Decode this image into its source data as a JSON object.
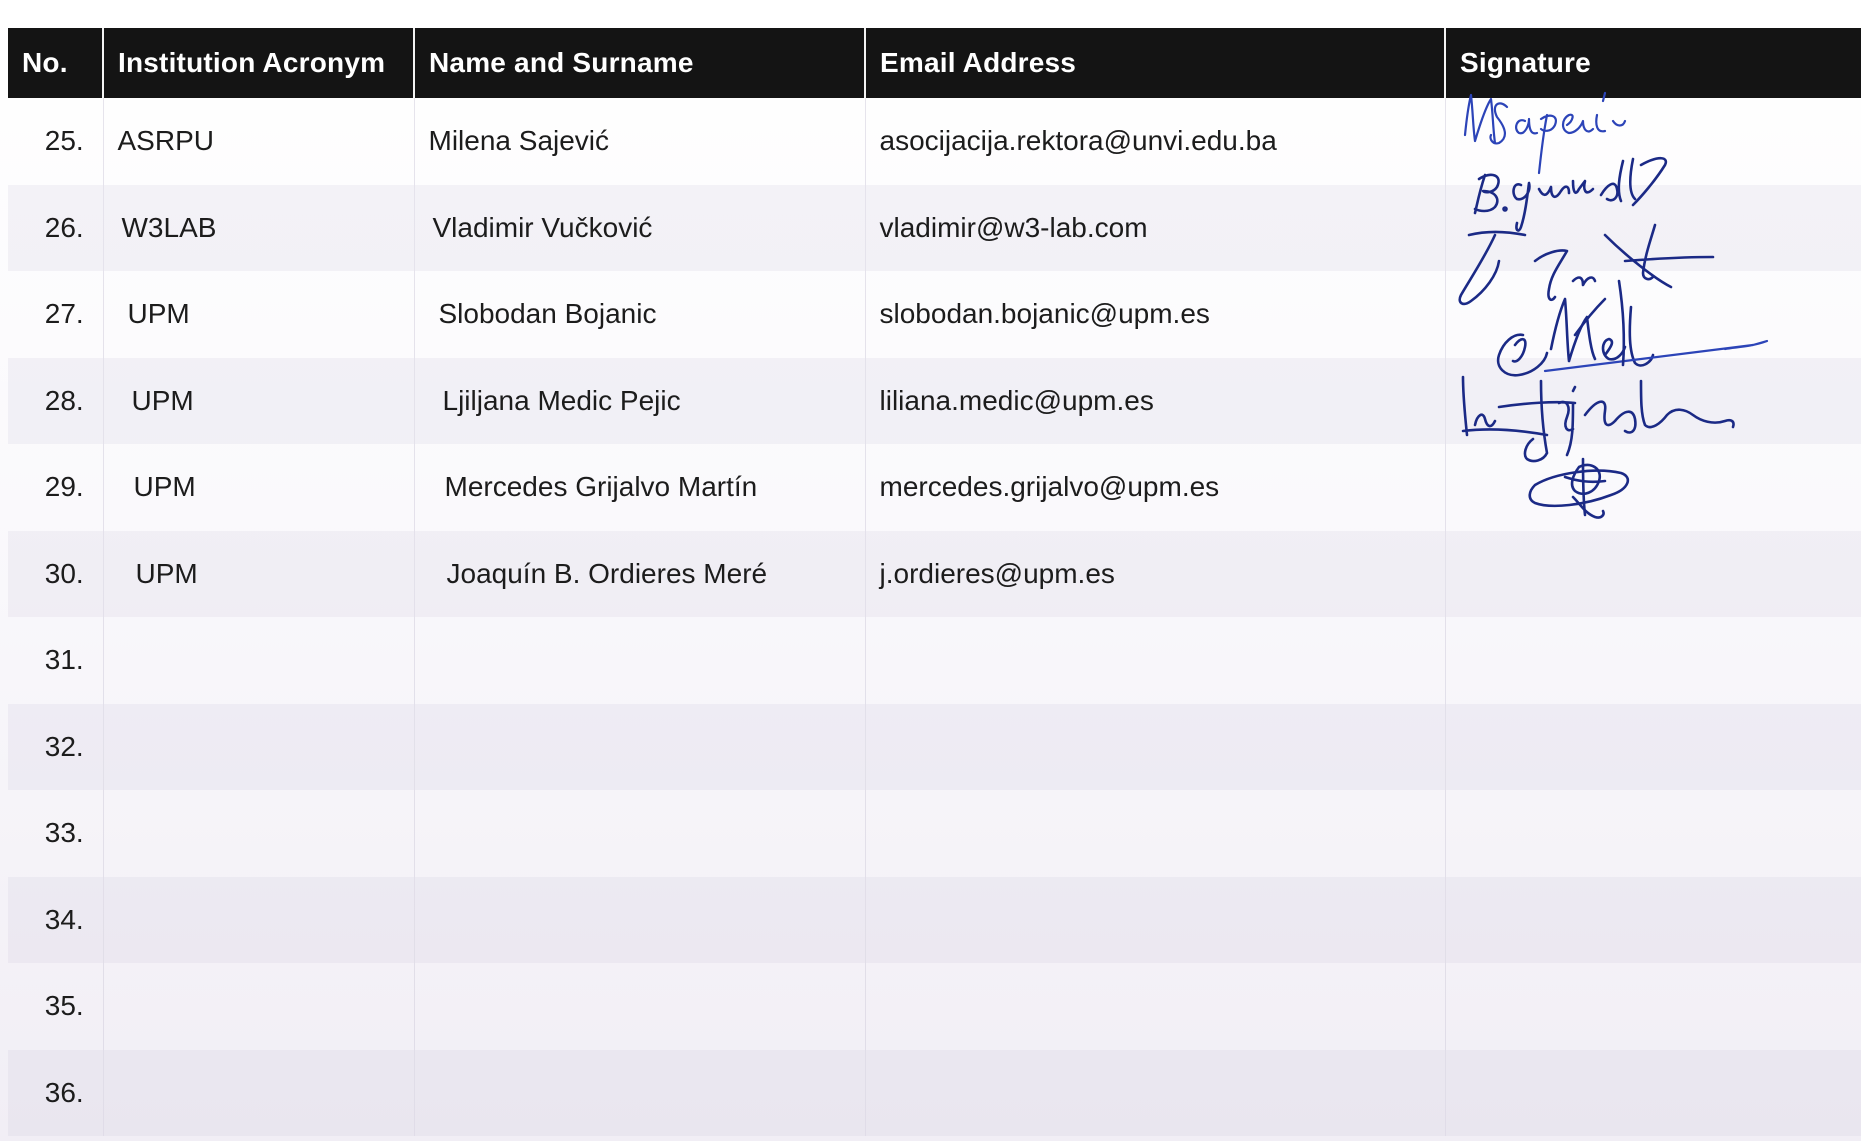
{
  "table": {
    "headers": {
      "no": "No.",
      "institution": "Institution Acronym",
      "name": "Name and Surname",
      "email": "Email Address",
      "signature": "Signature"
    },
    "rows": [
      {
        "no": "25.",
        "institution": "ASRPU",
        "name": "Milena Sajević",
        "email": "asocijacija.rektora@unvi.edu.ba",
        "signed": true
      },
      {
        "no": "26.",
        "institution": "W3LAB",
        "name": "Vladimir Vučković",
        "email": "vladimir@w3-lab.com",
        "signed": true
      },
      {
        "no": "27.",
        "institution": "UPM",
        "name": "Slobodan Bojanic",
        "email": "slobodan.bojanic@upm.es",
        "signed": true
      },
      {
        "no": "28.",
        "institution": "UPM",
        "name": "Ljiljana Medic Pejic",
        "email": "liliana.medic@upm.es",
        "signed": true
      },
      {
        "no": "29.",
        "institution": "UPM",
        "name": "Mercedes Grijalvo Martín",
        "email": "mercedes.grijalvo@upm.es",
        "signed": true
      },
      {
        "no": "30.",
        "institution": "UPM",
        "name": "Joaquín B. Ordieres Meré",
        "email": "j.ordieres@upm.es",
        "signed": true
      },
      {
        "no": "31.",
        "institution": "",
        "name": "",
        "email": "",
        "signed": false
      },
      {
        "no": "32.",
        "institution": "",
        "name": "",
        "email": "",
        "signed": false
      },
      {
        "no": "33.",
        "institution": "",
        "name": "",
        "email": "",
        "signed": false
      },
      {
        "no": "34.",
        "institution": "",
        "name": "",
        "email": "",
        "signed": false
      },
      {
        "no": "35.",
        "institution": "",
        "name": "",
        "email": "",
        "signed": false
      },
      {
        "no": "36.",
        "institution": "",
        "name": "",
        "email": "",
        "signed": false
      }
    ]
  },
  "colors": {
    "header_bg": "#141414",
    "header_text": "#ffffff",
    "signature_ink": "#1b2a86"
  }
}
